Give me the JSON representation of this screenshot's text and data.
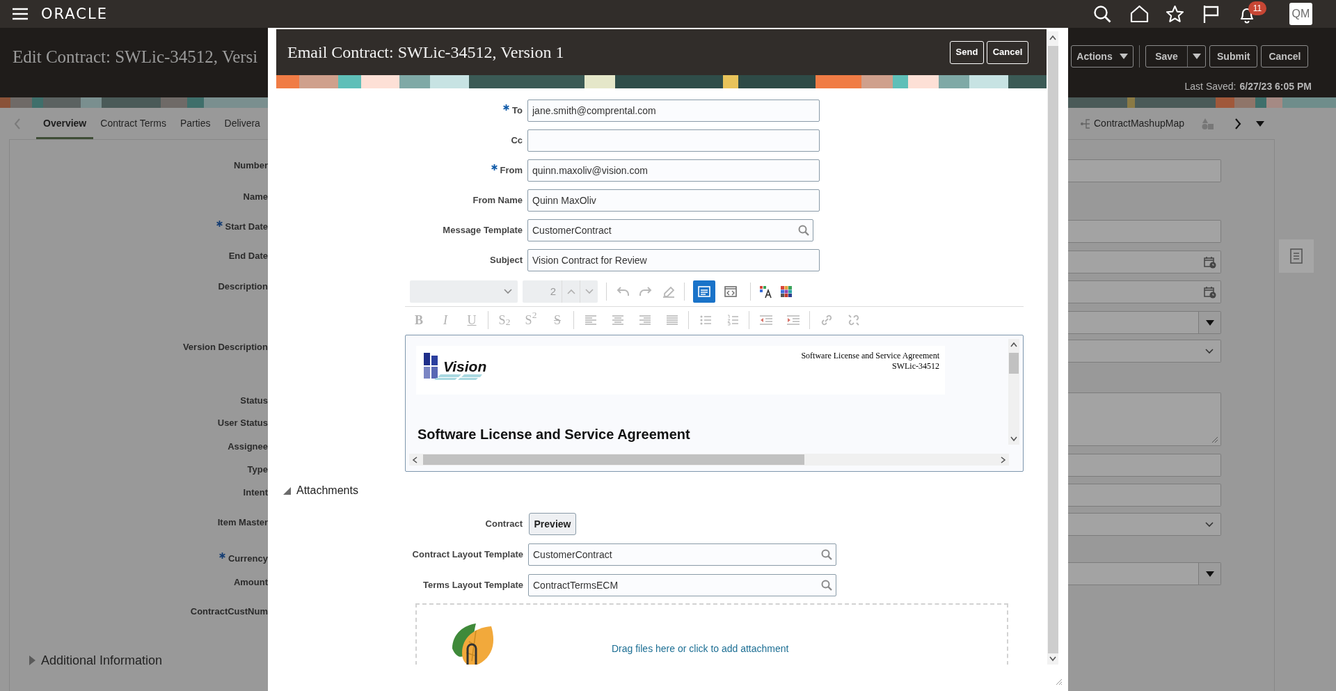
{
  "top_bar": {
    "logo": "ORACLE",
    "notification_count": "11",
    "avatar": "QM"
  },
  "page": {
    "title": "Edit Contract: SWLic-34512, Versi",
    "actions": [
      {
        "label": "Actions",
        "kind": "menu"
      },
      {
        "label": "Save",
        "kind": "split"
      },
      {
        "label": "Submit",
        "kind": "plain"
      },
      {
        "label": "Cancel",
        "kind": "plain"
      }
    ],
    "last_saved": {
      "label": "Last Saved:",
      "value": "6/27/23 6:05 PM"
    },
    "tabs": [
      {
        "label": "Overview",
        "selected": true
      },
      {
        "label": "Contract Terms",
        "selected": false
      },
      {
        "label": "Parties",
        "selected": false
      },
      {
        "label": "Delivera",
        "selected": false
      }
    ],
    "right_tab": "ContractMashupMap",
    "form_labels": [
      {
        "label": "Number",
        "required": false
      },
      {
        "label": "Name",
        "required": false
      },
      {
        "label": "Start Date",
        "required": true
      },
      {
        "label": "End Date",
        "required": false
      },
      {
        "label": "Description",
        "required": false
      },
      {
        "label": "Version Description",
        "required": false
      },
      {
        "label": "Status",
        "required": false
      },
      {
        "label": "User Status",
        "required": false
      },
      {
        "label": "Assignee",
        "required": false
      },
      {
        "label": "Type",
        "required": false
      },
      {
        "label": "Intent",
        "required": false
      },
      {
        "label": "Item Master",
        "required": false
      },
      {
        "label": "Currency",
        "required": true
      },
      {
        "label": "Amount",
        "required": false
      },
      {
        "label": "ContractCustNum",
        "required": false
      }
    ],
    "right_fields": [
      {
        "kind": "text"
      },
      {
        "kind": "text"
      },
      {
        "kind": "date"
      },
      {
        "kind": "date"
      },
      {
        "kind": "dropdown"
      },
      {
        "kind": "select"
      },
      {
        "kind": "textarea"
      },
      {
        "kind": "text"
      },
      {
        "kind": "text"
      },
      {
        "kind": "select"
      },
      {
        "kind": "dropdown"
      }
    ],
    "additional_information": {
      "label": "Additional Information",
      "expanded": false
    }
  },
  "dialog": {
    "title": "Email Contract: SWLic-34512, Version 1",
    "buttons": [
      "Send",
      "Cancel"
    ],
    "fields": [
      {
        "label": "To",
        "required": true,
        "value": "jane.smith@comprental.com",
        "kind": "text"
      },
      {
        "label": "Cc",
        "required": false,
        "kind": "text"
      },
      {
        "label": "From",
        "required": true,
        "value": "quinn.maxoliv@vision.com",
        "kind": "text"
      },
      {
        "label": "From Name",
        "required": false,
        "value": "Quinn MaxOliv",
        "kind": "text"
      },
      {
        "label": "Message Template",
        "required": false,
        "value": "CustomerContract",
        "kind": "lookup"
      },
      {
        "label": "Subject",
        "required": false,
        "value": "Vision Contract for Review",
        "kind": "text"
      }
    ],
    "editor": {
      "font_size": "2",
      "view_modes": [
        {
          "selected": true
        },
        {
          "selected": false
        }
      ],
      "format_buttons": [
        {
          "glyph": "B",
          "kind": "bold"
        },
        {
          "glyph": "I",
          "kind": "italic"
        },
        {
          "glyph": "U",
          "kind": "underline"
        },
        {
          "glyph": "S$_{2}$",
          "kind": "script"
        },
        {
          "glyph": "S$^{2}$",
          "kind": "script"
        },
        {
          "glyph": "S",
          "kind": "strike"
        }
      ],
      "document": {
        "logo_text": "Vision",
        "header_lines": [
          "Software License and Service Agreement",
          "SWLic-34512"
        ],
        "heading": "Software License and Service Agreement"
      }
    },
    "attachments": {
      "title": "Attachments",
      "expanded": true,
      "contract_label": "Contract",
      "preview_button": "Preview",
      "templates": [
        {
          "label": "Contract Layout Template",
          "value": "CustomerContract"
        },
        {
          "label": "Terms Layout Template",
          "value": "ContractTermsECM"
        }
      ],
      "drop_text": "Drag files here or click to add attachment"
    }
  }
}
